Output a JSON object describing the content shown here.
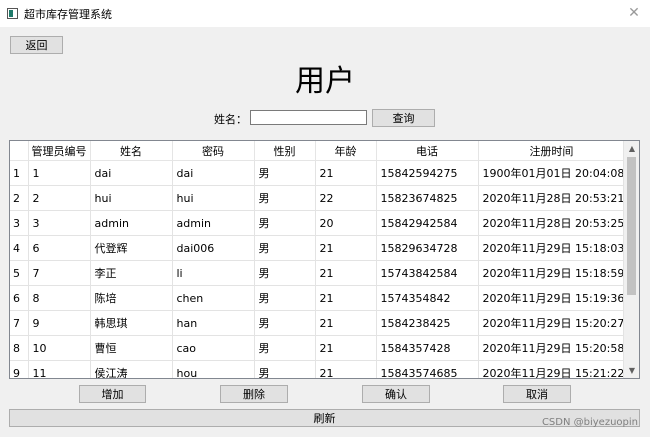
{
  "window": {
    "title": "超市库存管理系统",
    "close_glyph": "✕"
  },
  "back_label": "返回",
  "heading": "用户",
  "search": {
    "label": "姓名：",
    "value": "",
    "placeholder": "",
    "query_label": "查询"
  },
  "table": {
    "columns": [
      "管理员编号",
      "姓名",
      "密码",
      "性别",
      "年龄",
      "电话",
      "注册时间"
    ],
    "rows": [
      {
        "row_header": "1",
        "cells": [
          "1",
          "dai",
          "dai",
          "男",
          "21",
          "15842594275",
          "1900年01月01日 20:04:08"
        ]
      },
      {
        "row_header": "2",
        "cells": [
          "2",
          "hui",
          "hui",
          "男",
          "22",
          "15823674825",
          "2020年11月28日 20:53:21"
        ]
      },
      {
        "row_header": "3",
        "cells": [
          "3",
          "admin",
          "admin",
          "男",
          "20",
          "15842942584",
          "2020年11月28日 20:53:25"
        ]
      },
      {
        "row_header": "4",
        "cells": [
          "6",
          "代登辉",
          "dai006",
          "男",
          "21",
          "15829634728",
          "2020年11月29日 15:18:03"
        ]
      },
      {
        "row_header": "5",
        "cells": [
          "7",
          "李正",
          "li",
          "男",
          "21",
          "15743842584",
          "2020年11月29日 15:18:59"
        ]
      },
      {
        "row_header": "6",
        "cells": [
          "8",
          "陈培",
          "chen",
          "男",
          "21",
          "1574354842",
          "2020年11月29日 15:19:36"
        ]
      },
      {
        "row_header": "7",
        "cells": [
          "9",
          "韩思琪",
          "han",
          "男",
          "21",
          "1584238425",
          "2020年11月29日 15:20:27"
        ]
      },
      {
        "row_header": "8",
        "cells": [
          "10",
          "曹恒",
          "cao",
          "男",
          "21",
          "1584357428",
          "2020年11月29日 15:20:58"
        ]
      },
      {
        "row_header": "9",
        "cells": [
          "11",
          "侯江涛",
          "hou",
          "男",
          "21",
          "15843574685",
          "2020年11月29日 15:21:22"
        ]
      }
    ]
  },
  "scrollbar": {
    "up_glyph": "▲",
    "down_glyph": "▼"
  },
  "actions": {
    "add_label": "增加",
    "delete_label": "删除",
    "confirm_label": "确认",
    "cancel_label": "取消"
  },
  "refresh_label": "刷新",
  "watermark": "CSDN @biyezuopin"
}
